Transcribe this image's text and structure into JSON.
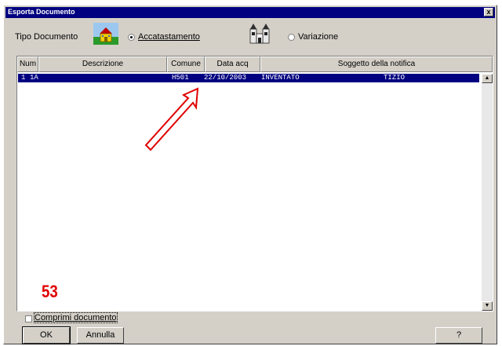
{
  "window": {
    "title": "Esporta Documento",
    "close_label": "x"
  },
  "tipo": {
    "label": "Tipo Documento",
    "options": [
      {
        "label": "Accatastamento",
        "selected": true
      },
      {
        "label": "Variazione",
        "selected": false
      }
    ]
  },
  "table": {
    "columns": [
      "Num",
      "Descrizione",
      "Comune",
      "Data acq",
      "Soggetto della notifica"
    ],
    "rows": [
      {
        "num": "1",
        "descrizione": "1A",
        "comune": "H501",
        "data_acq": "22/10/2003",
        "soggetto": "INVENTATO",
        "soggetto2": "TIZIO"
      }
    ]
  },
  "annotation": {
    "number": "53",
    "color": "#e00000"
  },
  "comprimi": {
    "label": "Comprimi documento",
    "checked": false
  },
  "buttons": {
    "ok": "OK",
    "annulla": "Annulla",
    "help": "?"
  },
  "colors": {
    "selection": "#000080",
    "face": "#d4d0c8"
  }
}
